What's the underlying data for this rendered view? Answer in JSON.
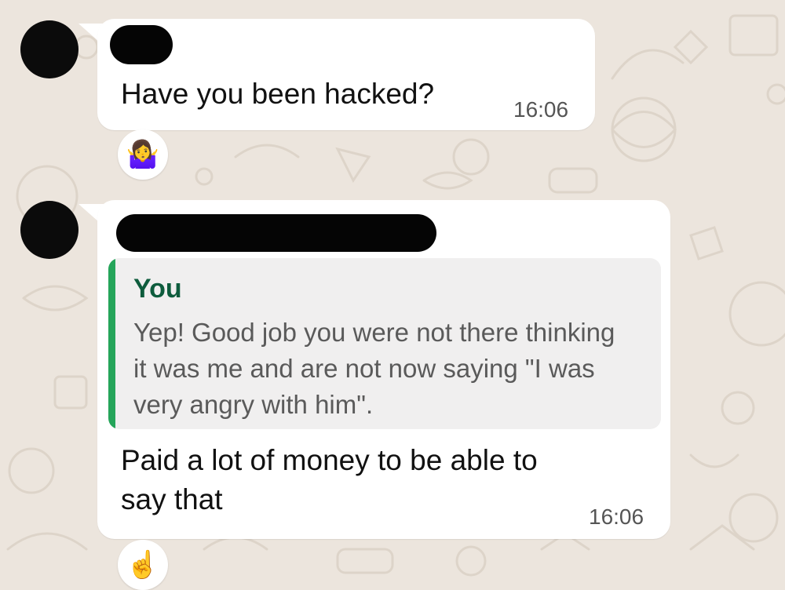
{
  "messages": [
    {
      "text": "Have you been hacked?",
      "time": "16:06",
      "reaction": "🤷‍♀️"
    },
    {
      "quote": {
        "author": "You",
        "text": "Yep! Good job you were not there thinking it was me and are not now saying \"I was very angry with him\"."
      },
      "text_line1": "Paid a lot of money to be able to",
      "text_line2": "say that",
      "time": "16:06",
      "reaction": "☝️"
    }
  ],
  "colors": {
    "background": "#ece5dd",
    "bubble": "#ffffff",
    "quote_bar": "#25a55a",
    "quote_author": "#0e5c3d"
  },
  "icons": [
    "person-shrugging-icon",
    "index-pointing-up-icon",
    "avatar-redacted",
    "name-redacted"
  ]
}
